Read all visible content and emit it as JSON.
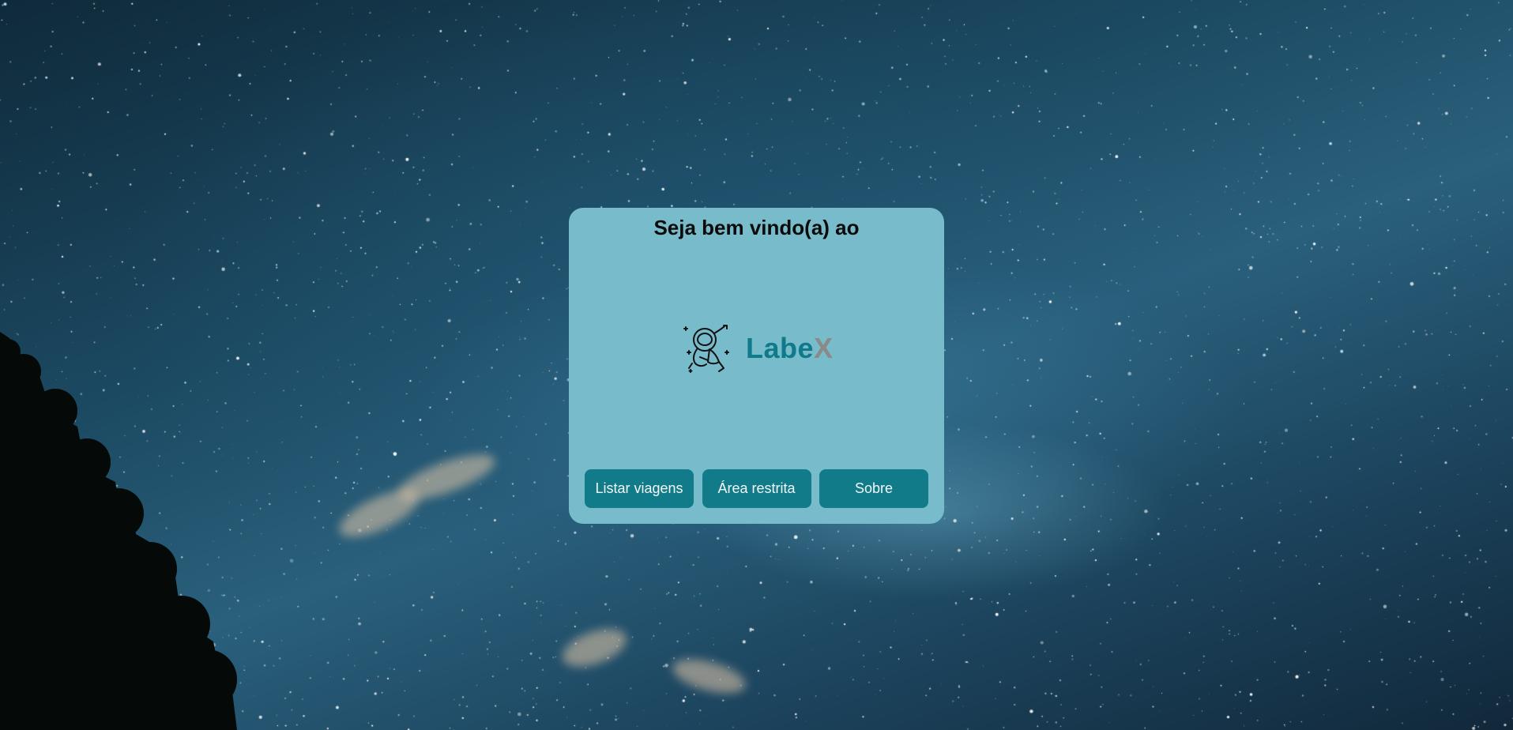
{
  "card": {
    "title": "Seja bem vindo(a) ao"
  },
  "logo": {
    "icon": "astronaut-icon",
    "text_part1": "Labe",
    "text_part2": "X",
    "colors": {
      "part1": "#0f7a8a",
      "part2": "#8a8a8a"
    }
  },
  "buttons": [
    {
      "label": "Listar viagens"
    },
    {
      "label": "Área restrita"
    },
    {
      "label": "Sobre"
    }
  ],
  "colors": {
    "card_background": "#78bccb",
    "button_background": "#127b8a",
    "button_text": "#f2f7f8"
  }
}
